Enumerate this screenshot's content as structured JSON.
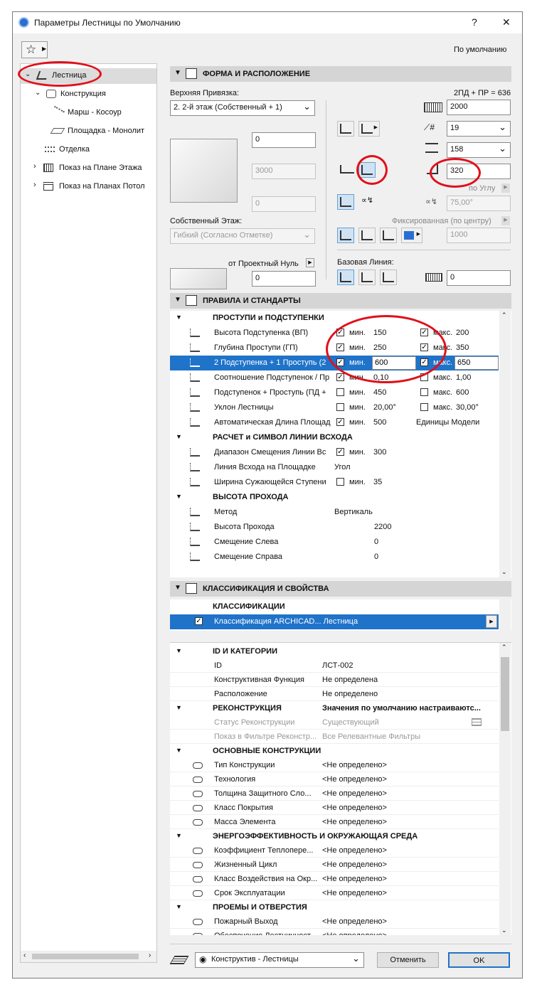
{
  "window": {
    "title": "Параметры Лестницы по Умолчанию",
    "help": "?",
    "close": "✕",
    "preset_label": "По умолчанию"
  },
  "tree": [
    {
      "label": "Лестница",
      "expanded": true,
      "selected": true
    },
    {
      "label": "Конструкция",
      "expanded": true
    },
    {
      "label": "Марш - Косоур"
    },
    {
      "label": "Площадка - Монолит"
    },
    {
      "label": "Отделка"
    },
    {
      "label": "Показ на Плане Этажа"
    },
    {
      "label": "Показ на Планах Потол"
    }
  ],
  "shape": {
    "section_title": "ФОРМА И РАСПОЛОЖЕНИЕ",
    "formula": "2ПД + ПР = 636",
    "top_link_label": "Верхняя Привязка:",
    "top_link_value": "2. 2-й этаж (Собственный + 1)",
    "offset_top": "0",
    "height": "3000",
    "offset_bottom": "0",
    "home_story_label": "Собственный Этаж:",
    "home_story_value": "Гибкий (Согласно Отметке)",
    "project_zero_label": "от Проектный Нуль",
    "project_zero_value": "0",
    "total_height": "2000",
    "risers": "19",
    "riser_height": "158",
    "tread_depth": "320",
    "by_angle": "по Углу",
    "angle": "75,00°",
    "fixed_center": "Фиксированная (по центру)",
    "width": "1000",
    "baseline_label": "Базовая Линия:",
    "baseline_offset": "0"
  },
  "rules": {
    "section_title": "ПРАВИЛА И СТАНДАРТЫ",
    "group1": "ПРОСТУПИ и ПОДСТУПЕНКИ",
    "rows1": [
      {
        "name": "Высота Подступенка (ВП)",
        "min_checked": true,
        "min_label": "мин.",
        "min": "150",
        "max_checked": true,
        "max_label": "макс.",
        "max": "200"
      },
      {
        "name": "Глубина Проступи (ГП)",
        "min_checked": true,
        "min_label": "мин.",
        "min": "250",
        "max_checked": true,
        "max_label": "макс.",
        "max": "350"
      },
      {
        "name": "2 Подступенка + 1 Проступь (2",
        "min_checked": true,
        "min_label": "мин.",
        "min": "600",
        "max_checked": true,
        "max_label": "макс.",
        "max": "650"
      },
      {
        "name": "Соотношение Подступенок / Пр",
        "min_checked": true,
        "min_label": "мин.",
        "min": "0,10",
        "max_checked": false,
        "max_label": "макс.",
        "max": "1,00"
      },
      {
        "name": "Подступенок + Проступь (ПД +",
        "min_checked": false,
        "min_label": "мин.",
        "min": "450",
        "max_checked": false,
        "max_label": "макс.",
        "max": "600"
      },
      {
        "name": "Уклон Лестницы",
        "min_checked": false,
        "min_label": "мин.",
        "min": "20,00°",
        "max_checked": false,
        "max_label": "макс.",
        "max": "30,00°"
      },
      {
        "name": "Автоматическая Длина Площад",
        "min_checked": true,
        "min_label": "мин.",
        "min": "500",
        "units": "Единицы Модели"
      }
    ],
    "group2": "РАСЧЕТ и СИМВОЛ ЛИНИИ ВСХОДА",
    "rows2": [
      {
        "name": "Диапазон Смещения Линии Вс",
        "checked": true,
        "min_label": "мин.",
        "value": "300"
      },
      {
        "name": "Линия Всхода на Площадке",
        "value": "Угол"
      },
      {
        "name": "Ширина Сужающейся Ступени",
        "checked": false,
        "min_label": "мин.",
        "value": "35"
      }
    ],
    "group3": "ВЫСОТА ПРОХОДА",
    "rows3": [
      {
        "name": "Метод",
        "value": "Вертикаль"
      },
      {
        "name": "Высота Прохода",
        "value": "2200"
      },
      {
        "name": "Смещение Слева",
        "value": "0"
      },
      {
        "name": "Смещение Справа",
        "value": "0"
      }
    ]
  },
  "classification": {
    "section_title": "КЛАССИФИКАЦИЯ И СВОЙСТВА",
    "group": "КЛАССИФИКАЦИИ",
    "row": "Классификация ARCHICAD... Лестница"
  },
  "props": {
    "group_id": "ID И КАТЕГОРИИ",
    "rows_id": [
      {
        "name": "ID",
        "value": "ЛСТ-002"
      },
      {
        "name": "Конструктивная Функция",
        "value": "Не определена"
      },
      {
        "name": "Расположение",
        "value": "Не определено"
      }
    ],
    "group_recon": "РЕКОНСТРУКЦИЯ",
    "recon_value": "Значения по умолчанию настраиваютс...",
    "rows_recon": [
      {
        "name": "Статус Реконструкции",
        "value": "Существующий"
      },
      {
        "name": "Показ в Фильтре Реконстр...",
        "value": "Все Релевантные Фильтры"
      }
    ],
    "group_main": "ОСНОВНЫЕ КОНСТРУКЦИИ",
    "rows_main": [
      {
        "name": "Тип Конструкции",
        "value": "<Не определено>"
      },
      {
        "name": "Технология",
        "value": "<Не определено>"
      },
      {
        "name": "Толщина Защитного Сло...",
        "value": "<Не определено>"
      },
      {
        "name": "Класс Покрытия",
        "value": "<Не определено>"
      },
      {
        "name": "Масса Элемента",
        "value": "<Не определено>"
      }
    ],
    "group_energy": "ЭНЕРГОЭФФЕКТИВНОСТЬ И ОКРУЖАЮЩАЯ СРЕДА",
    "rows_energy": [
      {
        "name": "Коэффициент Теплопере...",
        "value": "<Не определено>"
      },
      {
        "name": "Жизненный Цикл",
        "value": "<Не определено>"
      },
      {
        "name": "Класс Воздействия на Окр...",
        "value": "<Не определено>"
      },
      {
        "name": "Срок Эксплуатации",
        "value": "<Не определено>"
      }
    ],
    "group_open": "ПРОЕМЫ И ОТВЕРСТИЯ",
    "rows_open": [
      {
        "name": "Пожарный Выход",
        "value": "<Не определено>"
      },
      {
        "name": "Обеспечение Лестничност...",
        "value": "<Не определено>"
      }
    ]
  },
  "footer": {
    "layer": "Конструктив - Лестницы",
    "cancel": "Отменить",
    "ok": "OK"
  }
}
